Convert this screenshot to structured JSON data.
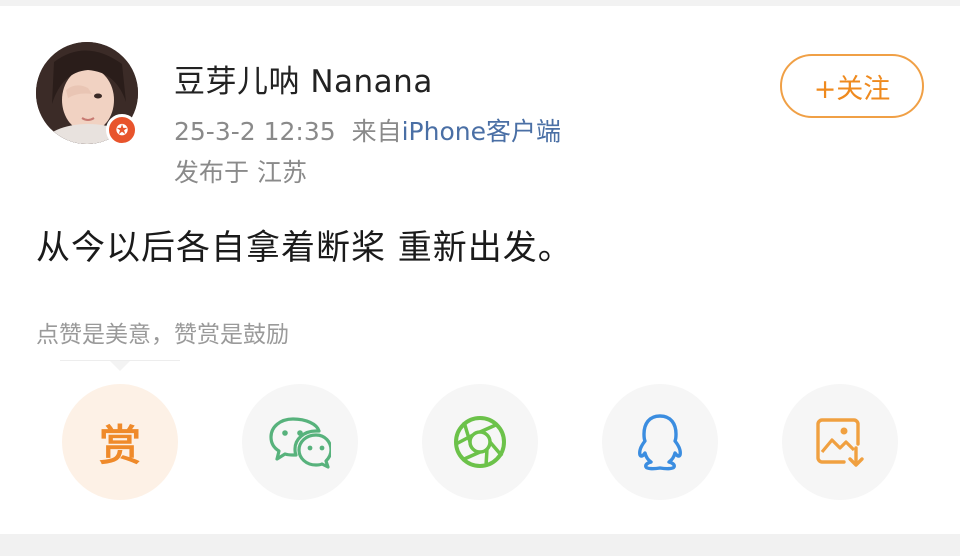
{
  "post": {
    "author": {
      "name": "豆芽儿呐 Nanana",
      "badge_icon": "vip-star-icon"
    },
    "timestamp": "25-3-2 12:35",
    "source_prefix": "来自",
    "source_client": "iPhone客户端",
    "location": "发布于 江苏",
    "follow_label": "+关注",
    "content": "从今以后各自拿着断桨 重新出发。"
  },
  "reward": {
    "hint": "点赞是美意，赞赏是鼓励",
    "button_glyph": "赏"
  },
  "share_actions": [
    {
      "name": "wechat",
      "icon": "wechat-icon",
      "color": "#57b27c"
    },
    {
      "name": "moments",
      "icon": "moments-icon",
      "color": "#6cc24a"
    },
    {
      "name": "qq",
      "icon": "qq-icon",
      "color": "#3b8de0"
    },
    {
      "name": "save-image",
      "icon": "save-image-icon",
      "color": "#f0a040"
    }
  ],
  "colors": {
    "accent_orange": "#ef8a1e",
    "link_blue": "#4a6fa5",
    "meta_gray": "#8a8a8a"
  }
}
